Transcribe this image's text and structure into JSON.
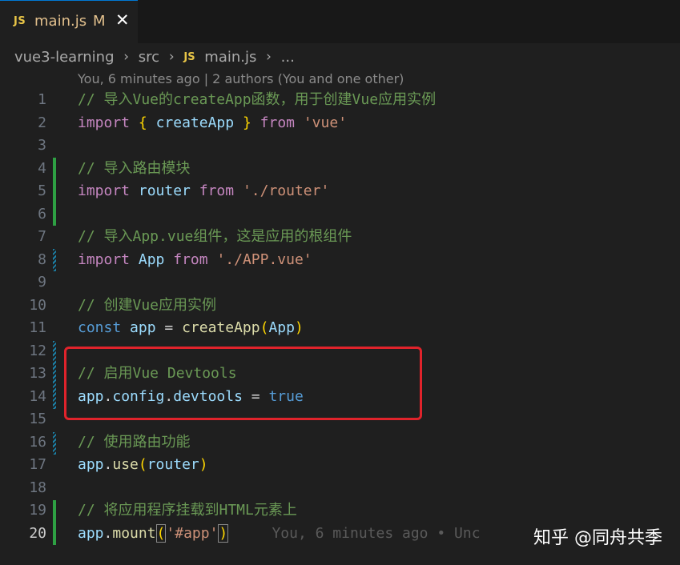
{
  "tab": {
    "title": "main.js",
    "modified": "M",
    "close": "✕",
    "badge": "JS"
  },
  "breadcrumb": {
    "project": "vue3-learning",
    "folder": "src",
    "file": "main.js",
    "more": "...",
    "sep": "›"
  },
  "blame": "You, 6 minutes ago | 2 authors (You and one other)",
  "lines": {
    "l1": {
      "n": "1",
      "comment": "// 导入Vue的createApp函数，用于创建Vue应用实例"
    },
    "l2": {
      "n": "2",
      "kw": "import",
      "ob": "{",
      "id": "createApp",
      "cb": "}",
      "from": "from",
      "str": "'vue'"
    },
    "l3": {
      "n": "3"
    },
    "l4": {
      "n": "4",
      "comment": "// 导入路由模块"
    },
    "l5": {
      "n": "5",
      "kw": "import",
      "id": "router",
      "from": "from",
      "str": "'./router'"
    },
    "l6": {
      "n": "6"
    },
    "l7": {
      "n": "7",
      "comment": "// 导入App.vue组件，这是应用的根组件"
    },
    "l8": {
      "n": "8",
      "kw": "import",
      "id": "App",
      "from": "from",
      "str": "'./APP.vue'"
    },
    "l9": {
      "n": "9"
    },
    "l10": {
      "n": "10",
      "comment": "// 创建Vue应用实例"
    },
    "l11": {
      "n": "11",
      "kw": "const",
      "id": "app",
      "eq": "=",
      "fn": "createApp",
      "op": "(",
      "arg": "App",
      "cp": ")"
    },
    "l12": {
      "n": "12"
    },
    "l13": {
      "n": "13",
      "comment": "// 启用Vue Devtools"
    },
    "l14": {
      "n": "14",
      "a": "app",
      "dot1": ".",
      "b": "config",
      "dot2": ".",
      "c": "devtools",
      "eq": "=",
      "val": "true"
    },
    "l15": {
      "n": "15"
    },
    "l16": {
      "n": "16",
      "comment": "// 使用路由功能"
    },
    "l17": {
      "n": "17",
      "a": "app",
      "dot": ".",
      "fn": "use",
      "op": "(",
      "arg": "router",
      "cp": ")"
    },
    "l18": {
      "n": "18"
    },
    "l19": {
      "n": "19",
      "comment": "// 将应用程序挂载到HTML元素上"
    },
    "l20": {
      "n": "20",
      "a": "app",
      "dot": ".",
      "fn": "mount",
      "op": "(",
      "arg": "'#app'",
      "cp": ")",
      "inline_blame": "You, 6 minutes ago • Unc"
    }
  },
  "watermark": "知乎 @同舟共季",
  "colors": {
    "accent": "#0078d4",
    "highlight": "#e0232b",
    "added": "#2ea043",
    "modified": "#1b81a8"
  }
}
